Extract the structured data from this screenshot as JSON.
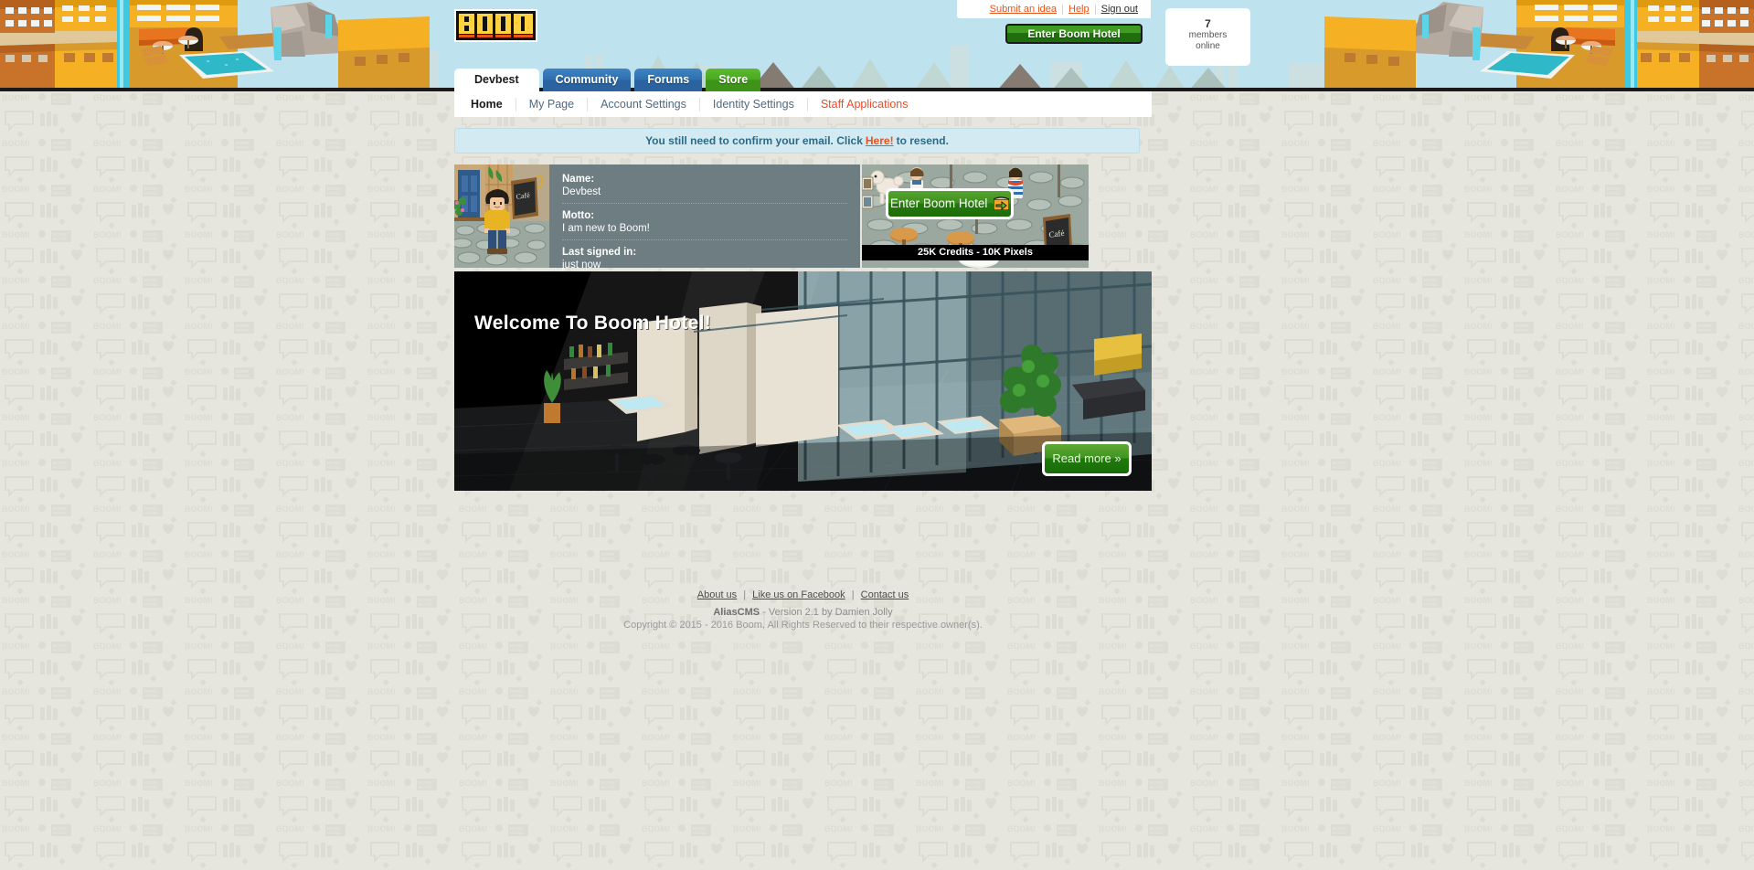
{
  "site": {
    "logo_text": "BOOM",
    "brand_yellow": "#ffd23f",
    "brand_green": "#3f9e21",
    "brand_orange": "#e8541b",
    "header_sky": "#bfe2ef",
    "page_bg": "#e6e6de"
  },
  "toplinks": {
    "submit_idea": "Submit an idea",
    "help": "Help",
    "sign_out": "Sign out"
  },
  "header": {
    "enter_hotel_label": "Enter Boom Hotel",
    "members_count": "7",
    "members_label_line1": "members",
    "members_label_line2": "online"
  },
  "tabs": [
    {
      "label": "Devbest",
      "state": "active"
    },
    {
      "label": "Community",
      "state": "blue"
    },
    {
      "label": "Forums",
      "state": "blue"
    },
    {
      "label": "Store",
      "state": "green"
    }
  ],
  "subnav": [
    {
      "label": "Home",
      "state": "active"
    },
    {
      "label": "My Page",
      "state": "normal"
    },
    {
      "label": "Account Settings",
      "state": "normal"
    },
    {
      "label": "Identity Settings",
      "state": "normal"
    },
    {
      "label": "Staff Applications",
      "state": "alert"
    }
  ],
  "alert": {
    "text_before": "You still need to confirm your email. Click",
    "link": "Here!",
    "text_after": "to resend."
  },
  "profile": {
    "name_label": "Name:",
    "name_value": "Devbest",
    "motto_label": "Motto:",
    "motto_value": "I am new to Boom!",
    "last_signed_label": "Last signed in:",
    "last_signed_value": "just now"
  },
  "promo": {
    "button_label": "Enter Boom Hotel",
    "caption": "25K Credits - 10K Pixels"
  },
  "hero": {
    "title": "Welcome To Boom Hotel!",
    "read_more": "Read more »"
  },
  "footer": {
    "links": [
      "About us",
      "Like us on Facebook",
      "Contact us"
    ],
    "separator": "|",
    "cms_name": "AliasCMS",
    "cms_version": " - Version 2.1 by Damien Jolly",
    "copyright": "Copyright © 2015 - 2016 Boom, All Rights Reserved to their respective owner(s)."
  },
  "bg_pattern": {
    "word_boom": "BOOM!",
    "word_hotel_line1": "BOOM",
    "word_hotel_line2": "HOTEL"
  }
}
